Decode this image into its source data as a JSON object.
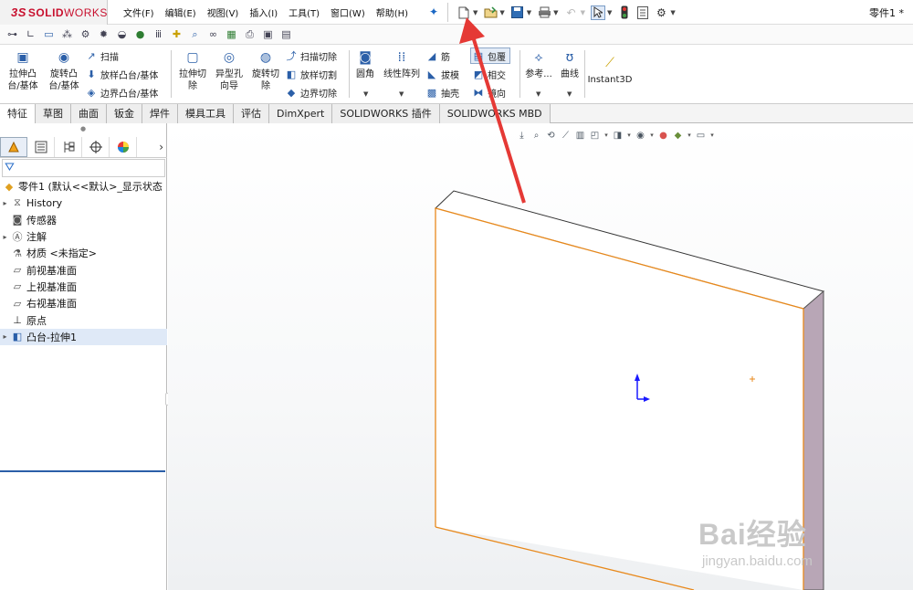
{
  "app": {
    "logo_ds": "3S",
    "logo_solid": "SOLID",
    "logo_works": "WORKS",
    "document_title": "零件1 *"
  },
  "menu": [
    "文件(F)",
    "编辑(E)",
    "视图(V)",
    "插入(I)",
    "工具(T)",
    "窗口(W)",
    "帮助(H)"
  ],
  "command_manager": {
    "extrude_boss": "拉伸凸\n台/基体",
    "revolve_boss": "旋转凸\n台/基体",
    "sweep": "扫描",
    "loft_boss": "放样凸台/基体",
    "boundary_boss": "边界凸台/基体",
    "extrude_cut": "拉伸切\n除",
    "hole_wizard": "异型孔\n向导",
    "revolve_cut": "旋转切\n除",
    "sweep_cut": "扫描切除",
    "loft_cut": "放样切割",
    "boundary_cut": "边界切除",
    "fillet": "圆角",
    "linear_pattern": "线性阵列",
    "rib": "筋",
    "draft": "拔模",
    "shell": "抽壳",
    "wrap": "包覆",
    "intersect": "相交",
    "mirror": "镜向",
    "reference": "参考...",
    "curves": "曲线",
    "instant3d": "Instant3D"
  },
  "tabs": [
    "特征",
    "草图",
    "曲面",
    "钣金",
    "焊件",
    "模具工具",
    "评估",
    "DimXpert",
    "SOLIDWORKS 插件",
    "SOLIDWORKS MBD"
  ],
  "tree": [
    {
      "label": "零件1 (默认<<默认>_显示状态",
      "icon": "part-icon",
      "twisty": ""
    },
    {
      "label": "History",
      "icon": "history-icon",
      "twisty": "▸"
    },
    {
      "label": "传感器",
      "icon": "sensor-icon",
      "twisty": ""
    },
    {
      "label": "注解",
      "icon": "annotation-icon",
      "twisty": "▸"
    },
    {
      "label": "材质 <未指定>",
      "icon": "material-icon",
      "twisty": ""
    },
    {
      "label": "前视基准面",
      "icon": "plane-icon",
      "twisty": ""
    },
    {
      "label": "上视基准面",
      "icon": "plane-icon",
      "twisty": ""
    },
    {
      "label": "右视基准面",
      "icon": "plane-icon",
      "twisty": ""
    },
    {
      "label": "原点",
      "icon": "origin-icon",
      "twisty": ""
    },
    {
      "label": "凸台-拉伸1",
      "icon": "extrude-feature-icon",
      "twisty": "▸"
    }
  ],
  "colors": {
    "accent": "#2b5fa8",
    "edge_highlight": "#e8891c",
    "annotation_arrow": "#e53935",
    "block_side": "#b8a6b6",
    "block_face": "#ffffff"
  },
  "watermark": {
    "main": "Bai经验",
    "sub": "jingyan.baidu.com"
  }
}
